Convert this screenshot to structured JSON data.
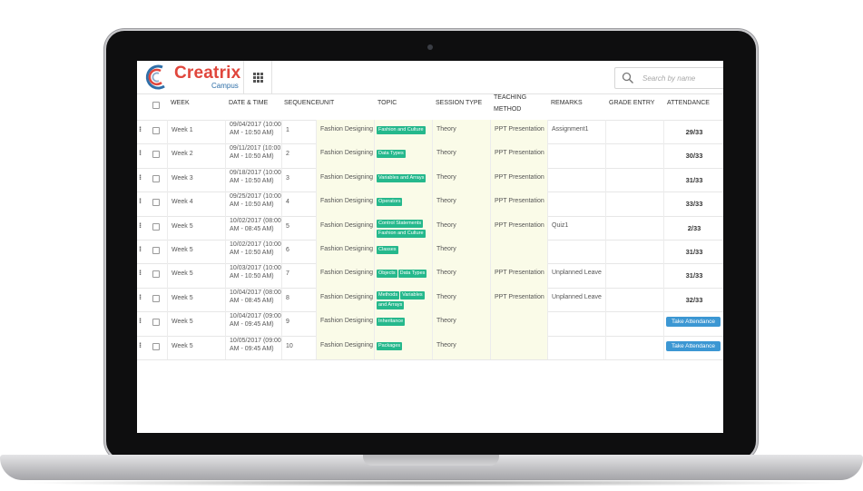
{
  "brand": {
    "name": "Creatrix",
    "sub": "Campus"
  },
  "search": {
    "placeholder": "Search by name"
  },
  "table": {
    "headers": {
      "week": "WEEK",
      "date_time": "DATE & TIME",
      "sequence": "SEQUENCE",
      "unit": "UNIT",
      "topic": "TOPIC",
      "session_type": "SESSION TYPE",
      "teaching_method_1": "TEACHING",
      "teaching_method_2": "METHOD",
      "remarks": "REMARKS",
      "grade_entry": "GRADE ENTRY",
      "attendance": "ATTENDANCE"
    },
    "rows": [
      {
        "week": "Week 1",
        "date1": "09/04/2017 (10:00",
        "date2": "AM - 10:50 AM)",
        "seq": "1",
        "unit": "Fashion Designing",
        "tags": [
          "Fashion and Culture"
        ],
        "session": "Theory",
        "method": "PPT Presentation",
        "remarks": "Assignment1",
        "grade": "",
        "attendance": "29/33",
        "action": ""
      },
      {
        "week": "Week 2",
        "date1": "09/11/2017 (10:00",
        "date2": "AM - 10:50 AM)",
        "seq": "2",
        "unit": "Fashion Designing",
        "tags": [
          "Data Types"
        ],
        "session": "Theory",
        "method": "PPT Presentation",
        "remarks": "",
        "grade": "",
        "attendance": "30/33",
        "action": ""
      },
      {
        "week": "Week 3",
        "date1": "09/18/2017 (10:00",
        "date2": "AM - 10:50 AM)",
        "seq": "3",
        "unit": "Fashion Designing",
        "tags": [
          "Variables and Arrays"
        ],
        "session": "Theory",
        "method": "PPT Presentation",
        "remarks": "",
        "grade": "",
        "attendance": "31/33",
        "action": ""
      },
      {
        "week": "Week 4",
        "date1": "09/25/2017 (10:00",
        "date2": "AM - 10:50 AM)",
        "seq": "4",
        "unit": "Fashion Designing",
        "tags": [
          "Operators"
        ],
        "session": "Theory",
        "method": "PPT Presentation",
        "remarks": "",
        "grade": "",
        "attendance": "33/33",
        "action": ""
      },
      {
        "week": "Week 5",
        "date1": "10/02/2017 (08:00",
        "date2": "AM - 08:45 AM)",
        "seq": "5",
        "unit": "Fashion Designing",
        "tags": [
          "Control Statements",
          "Fashion and Culture"
        ],
        "session": "Theory",
        "method": "PPT Presentation",
        "remarks": "Quiz1",
        "grade": "",
        "attendance": "2/33",
        "action": ""
      },
      {
        "week": "Week 5",
        "date1": "10/02/2017 (10:00",
        "date2": "AM - 10:50 AM)",
        "seq": "6",
        "unit": "Fashion Designing",
        "tags": [
          "Classes"
        ],
        "session": "Theory",
        "method": "",
        "remarks": "",
        "grade": "",
        "attendance": "31/33",
        "action": ""
      },
      {
        "week": "Week 5",
        "date1": "10/03/2017 (10:00",
        "date2": "AM - 10:50 AM)",
        "seq": "7",
        "unit": "Fashion Designing",
        "tags": [
          "Objects",
          "Data Types"
        ],
        "session": "Theory",
        "method": "PPT Presentation",
        "remarks": "Unplanned Leave",
        "grade": "",
        "attendance": "31/33",
        "action": ""
      },
      {
        "week": "Week 5",
        "date1": "10/04/2017 (08:00",
        "date2": "AM - 08:45 AM)",
        "seq": "8",
        "unit": "Fashion Designing",
        "tags": [
          "Methods",
          "Variables",
          "and Arrays"
        ],
        "session": "Theory",
        "method": "PPT Presentation",
        "remarks": "Unplanned Leave",
        "grade": "",
        "attendance": "32/33",
        "action": ""
      },
      {
        "week": "Week 5",
        "date1": "10/04/2017 (09:00",
        "date2": "AM - 09:45 AM)",
        "seq": "9",
        "unit": "Fashion Designing",
        "tags": [
          "Inheritance"
        ],
        "session": "Theory",
        "method": "",
        "remarks": "",
        "grade": "",
        "attendance": "",
        "action": "Take Attendance"
      },
      {
        "week": "Week 5",
        "date1": "10/05/2017 (09:00",
        "date2": "AM - 09:45 AM)",
        "seq": "10",
        "unit": "Fashion Designing",
        "tags": [
          "Packages"
        ],
        "session": "Theory",
        "method": "",
        "remarks": "",
        "grade": "",
        "attendance": "",
        "action": "Take Attendance"
      }
    ]
  },
  "colors": {
    "brand_red": "#e0463c",
    "brand_blue": "#2f6fa8",
    "tag_green": "#25b88c",
    "button_blue": "#3c97d3",
    "highlight_col": "#fafbe8"
  },
  "icons": {
    "logo": "creatrix-logo",
    "apps": "grid-icon",
    "search": "search-icon",
    "drag": "drag-handle-icon"
  }
}
